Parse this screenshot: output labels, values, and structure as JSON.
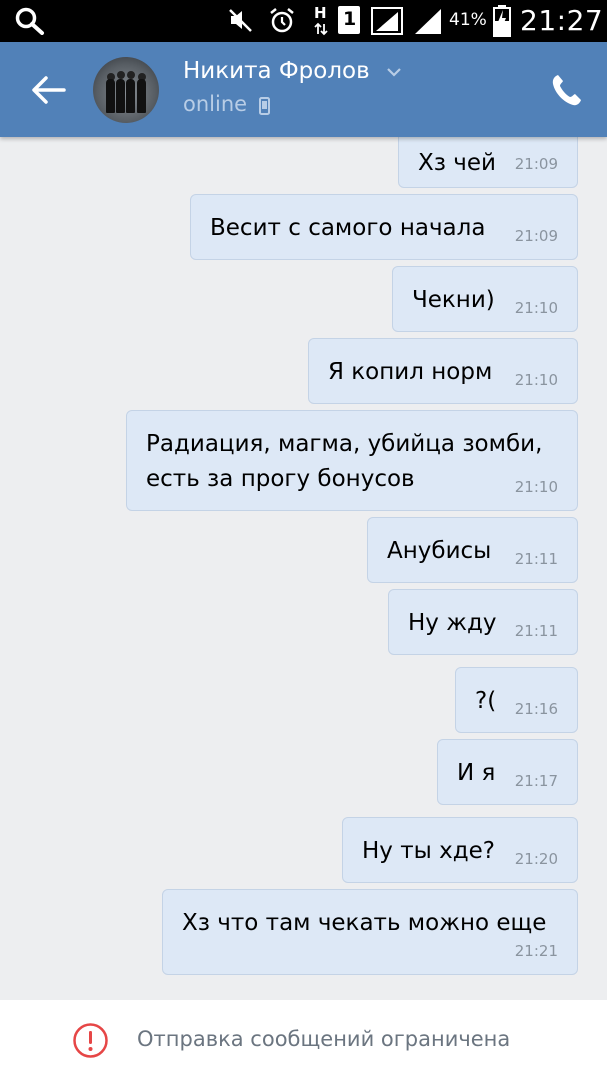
{
  "status_bar": {
    "battery_percent": "41%",
    "time": "21:27",
    "sim_label": "1",
    "network_label": "H"
  },
  "header": {
    "contact_name": "Никита Фролов",
    "contact_status": "online"
  },
  "messages": [
    {
      "text": "Хз чей",
      "time": "21:09"
    },
    {
      "text": "Весит с самого начала",
      "time": "21:09"
    },
    {
      "text": "Чекни)",
      "time": "21:10"
    },
    {
      "text": "Я копил норм",
      "time": "21:10"
    },
    {
      "text": "Радиация, магма, убийца зомби,\nесть за прогу бонусов",
      "time": "21:10"
    },
    {
      "text": "Анубисы",
      "time": "21:11"
    },
    {
      "text": "Ну жду",
      "time": "21:11"
    },
    {
      "text": "?(",
      "time": "21:16"
    },
    {
      "text": "И я",
      "time": "21:17"
    },
    {
      "text": "Ну ты хде?",
      "time": "21:20"
    },
    {
      "text": "Хз что там чекать можно еще",
      "time": "21:21"
    }
  ],
  "footer": {
    "notice": "Отправка сообщений ограничена"
  },
  "colors": {
    "header_bg": "#5181b8",
    "bubble_bg": "#dde8f6",
    "warning": "#e64646"
  }
}
